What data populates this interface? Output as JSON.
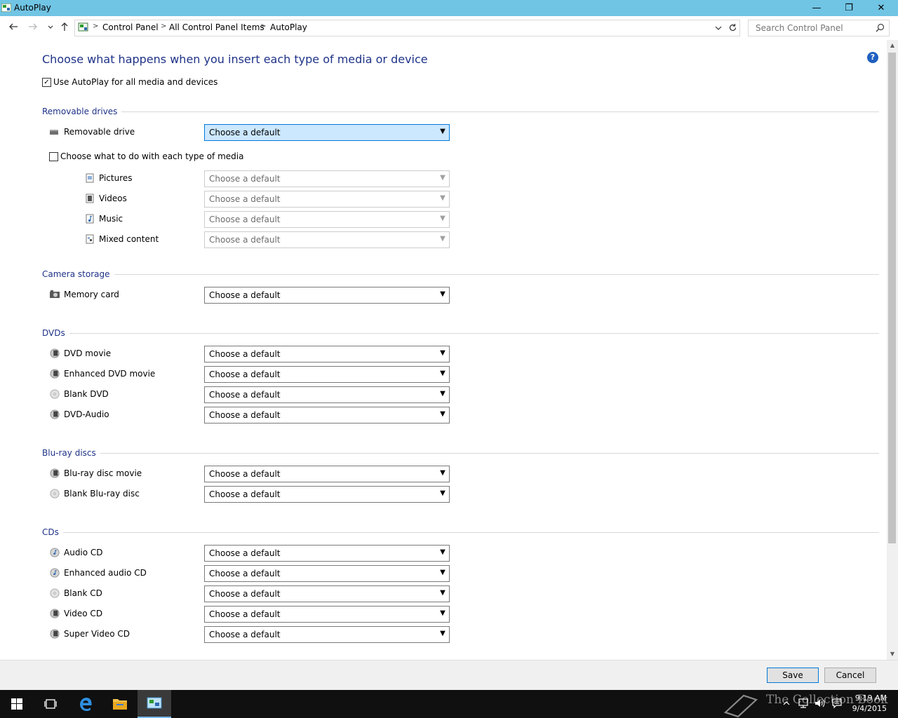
{
  "window": {
    "title": "AutoPlay",
    "minimize_glyph": "—",
    "restore_glyph": "❐",
    "close_glyph": "✕"
  },
  "nav": {
    "back_icon": "arrow-left-icon",
    "forward_icon": "arrow-right-icon",
    "up_icon": "arrow-up-icon",
    "breadcrumbs": [
      "Control Panel",
      "All Control Panel Items",
      "AutoPlay"
    ],
    "search_placeholder": "Search Control Panel"
  },
  "main": {
    "heading": "Choose what happens when you insert each type of media or device",
    "use_autoplay": {
      "label": "Use AutoPlay for all media and devices",
      "checked": true
    },
    "default_value": "Choose a default",
    "sections": {
      "removable": {
        "title": "Removable drives",
        "drive_label": "Removable drive",
        "each_media": {
          "label": "Choose what to do with each type of media",
          "checked": false
        },
        "media": [
          "Pictures",
          "Videos",
          "Music",
          "Mixed content"
        ]
      },
      "camera": {
        "title": "Camera storage",
        "items": [
          "Memory card"
        ]
      },
      "dvds": {
        "title": "DVDs",
        "items": [
          "DVD movie",
          "Enhanced DVD movie",
          "Blank DVD",
          "DVD-Audio"
        ]
      },
      "bluray": {
        "title": "Blu-ray discs",
        "items": [
          "Blu-ray disc movie",
          "Blank Blu-ray disc"
        ]
      },
      "cds": {
        "title": "CDs",
        "items": [
          "Audio CD",
          "Enhanced audio CD",
          "Blank CD",
          "Video CD",
          "Super Video CD"
        ]
      }
    }
  },
  "footer": {
    "save": "Save",
    "cancel": "Cancel"
  },
  "taskbar": {
    "time": "9:19 AM",
    "date": "9/4/2015",
    "watermark": "The Collection Book"
  },
  "colors": {
    "titlebar": "#70c4e4",
    "heading": "#1e3287",
    "highlight": "#cce8ff",
    "taskbar": "#101010"
  }
}
